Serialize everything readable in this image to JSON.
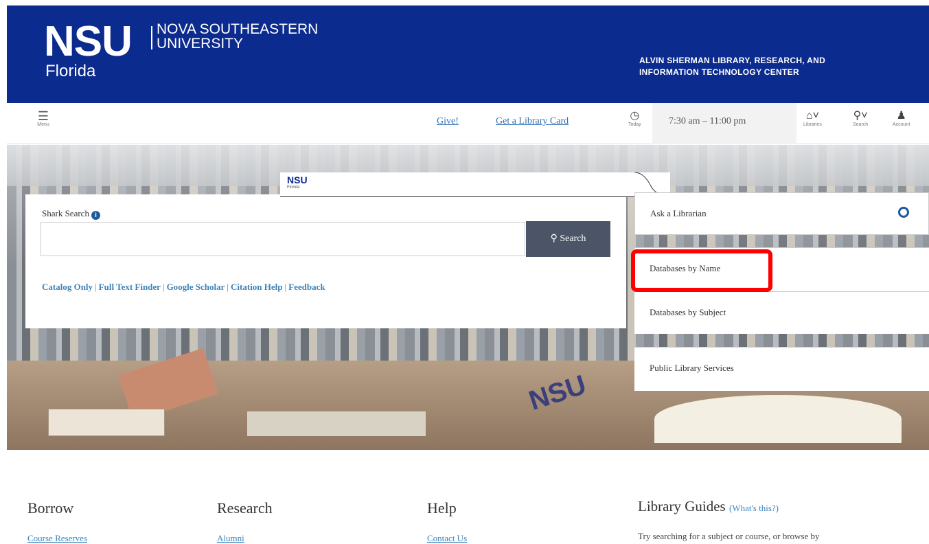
{
  "header": {
    "logo_nsu": "NSU",
    "logo_florida": "Florida",
    "university": [
      "NOVA SOUTHEASTERN",
      "UNIVERSITY"
    ],
    "library_title": [
      "ALVIN SHERMAN LIBRARY, RESEARCH, AND",
      "INFORMATION TECHNOLOGY CENTER"
    ]
  },
  "toolbar": {
    "menu_label": "Menu",
    "give": "Give!",
    "library_card": "Get a Library Card",
    "today_label": "Today",
    "hours": "7:30 am – 11:00 pm",
    "libraries_label": "Libraries",
    "search_label": "Search",
    "account_label": "Account"
  },
  "tab_overlay": {
    "logo": "NSU",
    "sub": "Florida"
  },
  "search": {
    "label": "Shark Search",
    "button": "Search",
    "links": [
      "Catalog Only",
      "Full Text Finder",
      "Google Scholar",
      "Citation Help",
      "Feedback"
    ]
  },
  "hero": {
    "stamp": "NSU"
  },
  "quick_links": {
    "ask": "Ask a Librarian",
    "db_name": "Databases by Name",
    "db_subject": "Databases by Subject",
    "public": "Public Library Services"
  },
  "footer": {
    "borrow": {
      "title": "Borrow",
      "link": "Course Reserves"
    },
    "research": {
      "title": "Research",
      "link": "Alumni"
    },
    "help": {
      "title": "Help",
      "link": "Contact Us"
    },
    "guides": {
      "title": "Library Guides",
      "whats_this": "(What's this?)",
      "text": "Try searching for a subject or course, or browse by"
    }
  }
}
